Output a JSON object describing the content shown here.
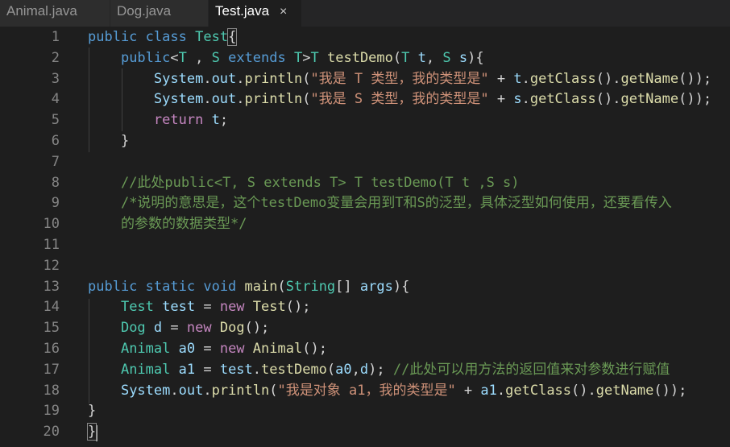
{
  "tabs": [
    {
      "label": "Animal.java"
    },
    {
      "label": "Dog.java"
    },
    {
      "label": "Test.java",
      "close_glyph": "×"
    }
  ],
  "line_numbers": [
    "1",
    "2",
    "3",
    "4",
    "5",
    "6",
    "7",
    "8",
    "9",
    "10",
    "11",
    "12",
    "13",
    "14",
    "15",
    "16",
    "17",
    "18",
    "19",
    "20"
  ],
  "code_lines": [
    [
      {
        "t": "public",
        "c": "kw"
      },
      {
        "t": " "
      },
      {
        "t": "class",
        "c": "kw"
      },
      {
        "t": " "
      },
      {
        "t": "Test",
        "c": "ty"
      },
      {
        "t": "{",
        "c": "pun brk"
      }
    ],
    [
      {
        "t": "    "
      },
      {
        "t": "public",
        "c": "kw"
      },
      {
        "t": "<"
      },
      {
        "t": "T",
        "c": "ty"
      },
      {
        "t": " , "
      },
      {
        "t": "S",
        "c": "ty"
      },
      {
        "t": " "
      },
      {
        "t": "extends",
        "c": "kw"
      },
      {
        "t": " "
      },
      {
        "t": "T",
        "c": "ty"
      },
      {
        "t": ">"
      },
      {
        "t": "T",
        "c": "ty"
      },
      {
        "t": " "
      },
      {
        "t": "testDemo",
        "c": "fn"
      },
      {
        "t": "("
      },
      {
        "t": "T",
        "c": "ty"
      },
      {
        "t": " "
      },
      {
        "t": "t",
        "c": "var"
      },
      {
        "t": ", "
      },
      {
        "t": "S",
        "c": "ty"
      },
      {
        "t": " "
      },
      {
        "t": "s",
        "c": "var"
      },
      {
        "t": "){"
      }
    ],
    [
      {
        "t": "        "
      },
      {
        "t": "System",
        "c": "var"
      },
      {
        "t": "."
      },
      {
        "t": "out",
        "c": "var"
      },
      {
        "t": "."
      },
      {
        "t": "println",
        "c": "fn"
      },
      {
        "t": "("
      },
      {
        "t": "\"我是 T 类型，我的类型是\"",
        "c": "str"
      },
      {
        "t": " + "
      },
      {
        "t": "t",
        "c": "var"
      },
      {
        "t": "."
      },
      {
        "t": "getClass",
        "c": "fn"
      },
      {
        "t": "()."
      },
      {
        "t": "getName",
        "c": "fn"
      },
      {
        "t": "());"
      }
    ],
    [
      {
        "t": "        "
      },
      {
        "t": "System",
        "c": "var"
      },
      {
        "t": "."
      },
      {
        "t": "out",
        "c": "var"
      },
      {
        "t": "."
      },
      {
        "t": "println",
        "c": "fn"
      },
      {
        "t": "("
      },
      {
        "t": "\"我是 S 类型，我的类型是\"",
        "c": "str"
      },
      {
        "t": " + "
      },
      {
        "t": "s",
        "c": "var"
      },
      {
        "t": "."
      },
      {
        "t": "getClass",
        "c": "fn"
      },
      {
        "t": "()."
      },
      {
        "t": "getName",
        "c": "fn"
      },
      {
        "t": "());"
      }
    ],
    [
      {
        "t": "        "
      },
      {
        "t": "return",
        "c": "ctl"
      },
      {
        "t": " "
      },
      {
        "t": "t",
        "c": "var"
      },
      {
        "t": ";"
      }
    ],
    [
      {
        "t": "    }"
      }
    ],
    [
      {
        "t": ""
      }
    ],
    [
      {
        "t": "    "
      },
      {
        "t": "//此处public<T, S extends T> T testDemo(T t ,S s)",
        "c": "cm"
      }
    ],
    [
      {
        "t": "    "
      },
      {
        "t": "/*说明的意思是，这个testDemo变量会用到T和S的泛型，具体泛型如何使用，还要看传入",
        "c": "cm"
      }
    ],
    [
      {
        "t": "    "
      },
      {
        "t": "的参数的数据类型*/",
        "c": "cm"
      }
    ],
    [
      {
        "t": ""
      }
    ],
    [
      {
        "t": ""
      }
    ],
    [
      {
        "t": "public",
        "c": "kw"
      },
      {
        "t": " "
      },
      {
        "t": "static",
        "c": "kw"
      },
      {
        "t": " "
      },
      {
        "t": "void",
        "c": "kw"
      },
      {
        "t": " "
      },
      {
        "t": "main",
        "c": "fn"
      },
      {
        "t": "("
      },
      {
        "t": "String",
        "c": "ty"
      },
      {
        "t": "[] "
      },
      {
        "t": "args",
        "c": "var"
      },
      {
        "t": "){"
      }
    ],
    [
      {
        "t": "    "
      },
      {
        "t": "Test",
        "c": "ty"
      },
      {
        "t": " "
      },
      {
        "t": "test",
        "c": "var"
      },
      {
        "t": " = "
      },
      {
        "t": "new",
        "c": "ctl"
      },
      {
        "t": " "
      },
      {
        "t": "Test",
        "c": "fn"
      },
      {
        "t": "();"
      }
    ],
    [
      {
        "t": "    "
      },
      {
        "t": "Dog",
        "c": "ty"
      },
      {
        "t": " "
      },
      {
        "t": "d",
        "c": "var"
      },
      {
        "t": " = "
      },
      {
        "t": "new",
        "c": "ctl"
      },
      {
        "t": " "
      },
      {
        "t": "Dog",
        "c": "fn"
      },
      {
        "t": "();"
      }
    ],
    [
      {
        "t": "    "
      },
      {
        "t": "Animal",
        "c": "ty"
      },
      {
        "t": " "
      },
      {
        "t": "a0",
        "c": "var"
      },
      {
        "t": " = "
      },
      {
        "t": "new",
        "c": "ctl"
      },
      {
        "t": " "
      },
      {
        "t": "Animal",
        "c": "fn"
      },
      {
        "t": "();"
      }
    ],
    [
      {
        "t": "    "
      },
      {
        "t": "Animal",
        "c": "ty"
      },
      {
        "t": " "
      },
      {
        "t": "a1",
        "c": "var"
      },
      {
        "t": " = "
      },
      {
        "t": "test",
        "c": "var"
      },
      {
        "t": "."
      },
      {
        "t": "testDemo",
        "c": "fn"
      },
      {
        "t": "("
      },
      {
        "t": "a0",
        "c": "var"
      },
      {
        "t": ","
      },
      {
        "t": "d",
        "c": "var"
      },
      {
        "t": "); "
      },
      {
        "t": "//此处可以用方法的返回值来对参数进行赋值",
        "c": "cm"
      }
    ],
    [
      {
        "t": "    "
      },
      {
        "t": "System",
        "c": "var"
      },
      {
        "t": "."
      },
      {
        "t": "out",
        "c": "var"
      },
      {
        "t": "."
      },
      {
        "t": "println",
        "c": "fn"
      },
      {
        "t": "("
      },
      {
        "t": "\"我是对象 a1，我的类型是\"",
        "c": "str"
      },
      {
        "t": " + "
      },
      {
        "t": "a1",
        "c": "var"
      },
      {
        "t": "."
      },
      {
        "t": "getClass",
        "c": "fn"
      },
      {
        "t": "()."
      },
      {
        "t": "getName",
        "c": "fn"
      },
      {
        "t": "());"
      }
    ],
    [
      {
        "t": "}"
      }
    ],
    [
      {
        "t": "}",
        "c": "pun brk"
      }
    ]
  ],
  "theme": {
    "background": "#1e1e1e",
    "tab_bar": "#252526",
    "keyword": "#569cd6",
    "control_keyword": "#c586c0",
    "type": "#4ec9b0",
    "function": "#dcdcaa",
    "string": "#ce9178",
    "variable": "#9cdcfe",
    "comment": "#6a9955",
    "line_number": "#858585"
  }
}
